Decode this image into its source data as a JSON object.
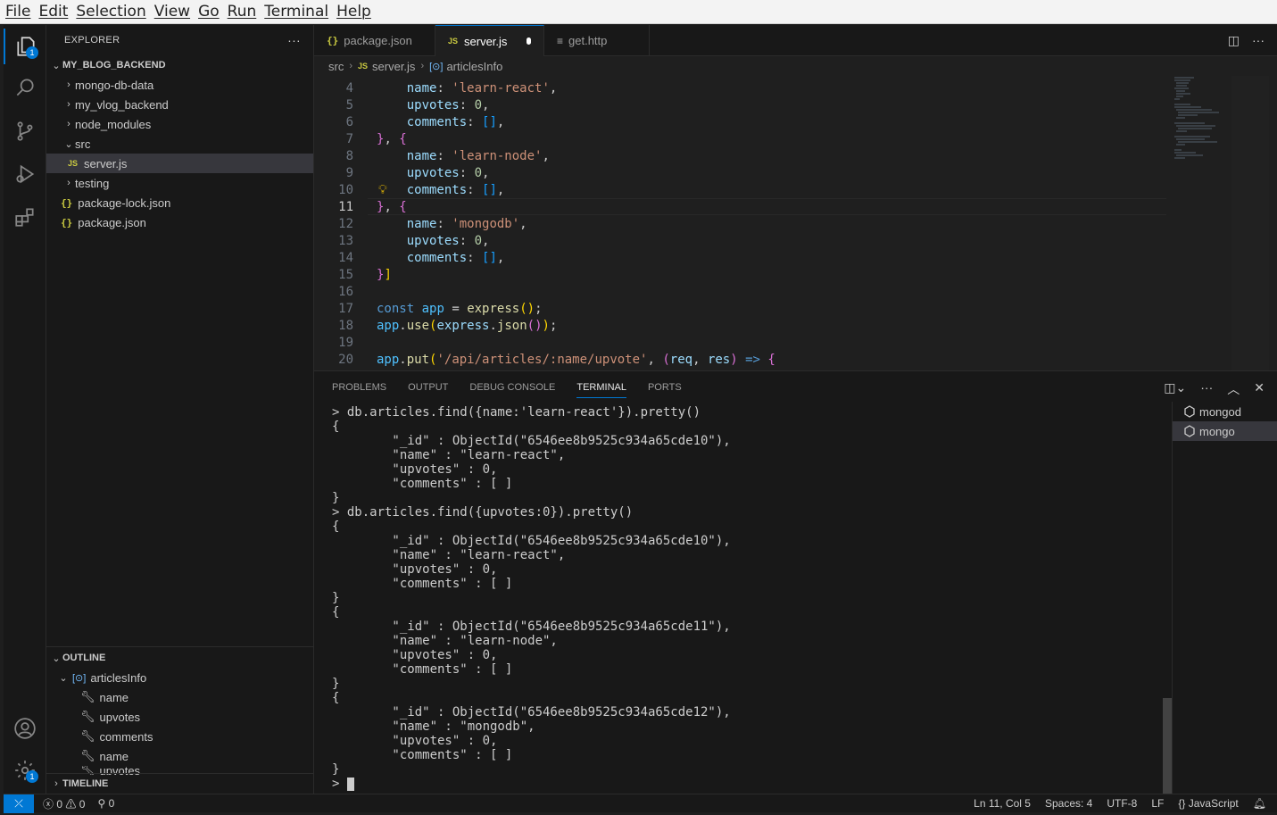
{
  "menu": [
    "File",
    "Edit",
    "Selection",
    "View",
    "Go",
    "Run",
    "Terminal",
    "Help"
  ],
  "activity": {
    "explorer_badge": "1",
    "settings_badge": "1"
  },
  "explorer": {
    "title": "EXPLORER",
    "more": "···",
    "root": "MY_BLOG_BACKEND",
    "items": [
      {
        "label": "mongo-db-data"
      },
      {
        "label": "my_vlog_backend"
      },
      {
        "label": "node_modules"
      },
      {
        "label": "src"
      },
      {
        "label": "server.js",
        "icon": "JS"
      },
      {
        "label": "testing"
      },
      {
        "label": "package-lock.json",
        "icon": "{}"
      },
      {
        "label": "package.json",
        "icon": "{}"
      }
    ]
  },
  "outline": {
    "title": "OUTLINE",
    "root": "articlesInfo",
    "items": [
      "name",
      "upvotes",
      "comments",
      "name",
      "upvotes"
    ]
  },
  "timeline": "TIMELINE",
  "tabs": [
    {
      "label": "package.json",
      "icon": "{}"
    },
    {
      "label": "server.js",
      "icon": "JS"
    },
    {
      "label": "get.http",
      "icon": "≡"
    }
  ],
  "breadcrumb": {
    "a": "src",
    "b": "server.js",
    "b_icon": "JS",
    "c": "articlesInfo"
  },
  "editor": {
    "lines": [
      "4",
      "5",
      "6",
      "7",
      "8",
      "9",
      "10",
      "11",
      "12",
      "13",
      "14",
      "15",
      "16",
      "17",
      "18",
      "19",
      "20"
    ]
  },
  "panel": {
    "tabs": [
      "PROBLEMS",
      "OUTPUT",
      "DEBUG CONSOLE",
      "TERMINAL",
      "PORTS"
    ],
    "terminal": "> db.articles.find({name:'learn-react'}).pretty()\n{\n        \"_id\" : ObjectId(\"6546ee8b9525c934a65cde10\"),\n        \"name\" : \"learn-react\",\n        \"upvotes\" : 0,\n        \"comments\" : [ ]\n}\n> db.articles.find({upvotes:0}).pretty()\n{\n        \"_id\" : ObjectId(\"6546ee8b9525c934a65cde10\"),\n        \"name\" : \"learn-react\",\n        \"upvotes\" : 0,\n        \"comments\" : [ ]\n}\n{\n        \"_id\" : ObjectId(\"6546ee8b9525c934a65cde11\"),\n        \"name\" : \"learn-node\",\n        \"upvotes\" : 0,\n        \"comments\" : [ ]\n}\n{\n        \"_id\" : ObjectId(\"6546ee8b9525c934a65cde12\"),\n        \"name\" : \"mongodb\",\n        \"upvotes\" : 0,\n        \"comments\" : [ ]\n}\n> ",
    "terminals": [
      "mongod",
      "mongo"
    ]
  },
  "status": {
    "errors": "0",
    "warnings": "0",
    "ports": "0",
    "position": "Ln 11, Col 5",
    "spaces": "Spaces: 4",
    "encoding": "UTF-8",
    "eol": "LF",
    "language": "JavaScript"
  },
  "colors": {
    "accent": "#0078d4",
    "background": "#1f1f1f",
    "sidebar": "#181818"
  }
}
